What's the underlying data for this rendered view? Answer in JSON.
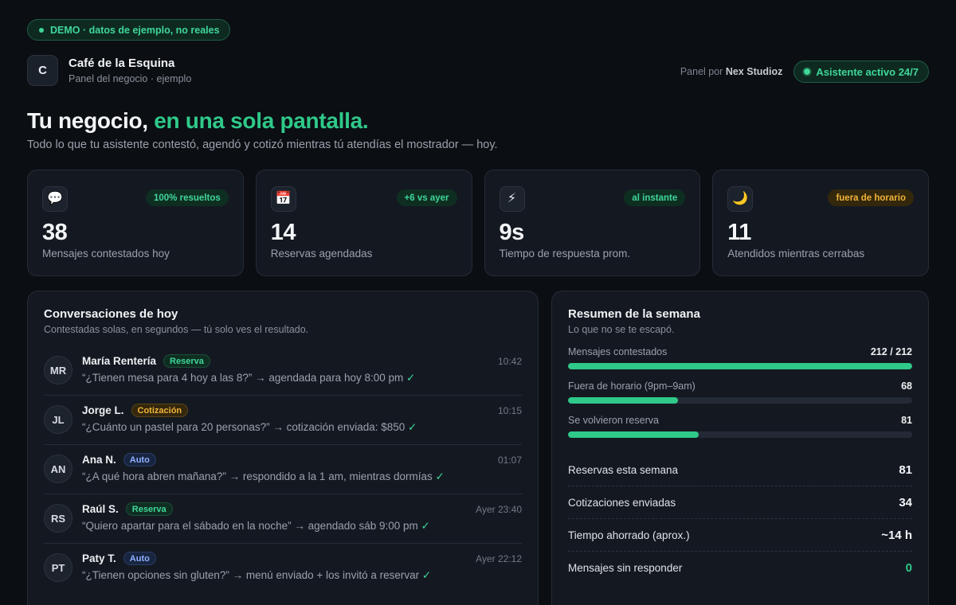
{
  "demo_pill": "DEMO · datos de ejemplo, no reales",
  "brand": {
    "initial": "C",
    "name": "Café de la Esquina",
    "subtitle": "Panel del negocio · ejemplo"
  },
  "header": {
    "panel_by_prefix": "Panel por",
    "panel_by_name": "Nex Studioz",
    "status": "Asistente activo 24/7"
  },
  "hero": {
    "title_plain": "Tu negocio, ",
    "title_accent": "en una sola pantalla.",
    "subtitle": "Todo lo que tu asistente contestó, agendó y cotizó mientras tú atendías el mostrador — hoy."
  },
  "stats": [
    {
      "icon": "💬",
      "icon_name": "speech-bubble-icon",
      "badge": "100% resueltos",
      "badge_kind": "good",
      "value": "38",
      "label": "Mensajes contestados hoy"
    },
    {
      "icon": "📅",
      "icon_name": "calendar-icon",
      "badge": "+6 vs ayer",
      "badge_kind": "good",
      "value": "14",
      "label": "Reservas agendadas"
    },
    {
      "icon": "⚡",
      "icon_name": "lightning-icon",
      "badge": "al instante",
      "badge_kind": "good",
      "value": "9s",
      "label": "Tiempo de respuesta prom."
    },
    {
      "icon": "🌙",
      "icon_name": "moon-icon",
      "badge": "fuera de horario",
      "badge_kind": "warn",
      "value": "11",
      "label": "Atendidos mientras cerrabas"
    }
  ],
  "conversations": {
    "title": "Conversaciones de hoy",
    "subtitle": "Contestadas solas, en segundos — tú solo ves el resultado.",
    "items": [
      {
        "initials": "MR",
        "name": "María Rentería",
        "tag": "Reserva",
        "tag_kind": "reserva",
        "message": "“¿Tienen mesa para 4 hoy a las 8?” → agendada para hoy 8:00 pm",
        "check": "✓",
        "time": "10:42"
      },
      {
        "initials": "JL",
        "name": "Jorge L.",
        "tag": "Cotización",
        "tag_kind": "cotizacion",
        "message": "“¿Cuánto un pastel para 20 personas?” → cotización enviada: $850",
        "check": "✓",
        "time": "10:15"
      },
      {
        "initials": "AN",
        "name": "Ana N.",
        "tag": "Auto",
        "tag_kind": "auto",
        "message": "“¿A qué hora abren mañana?” → respondido a la 1 am, mientras dormías",
        "check": "✓",
        "time": "01:07"
      },
      {
        "initials": "RS",
        "name": "Raúl S.",
        "tag": "Reserva",
        "tag_kind": "reserva",
        "message": "“Quiero apartar para el sábado en la noche” → agendado sáb 9:00 pm",
        "check": "✓",
        "time": "Ayer 23:40"
      },
      {
        "initials": "PT",
        "name": "Paty T.",
        "tag": "Auto",
        "tag_kind": "auto",
        "message": "“¿Tienen opciones sin gluten?” → menú enviado + los invitó a reservar",
        "check": "✓",
        "time": "Ayer 22:12"
      }
    ]
  },
  "weekly": {
    "title": "Resumen de la semana",
    "subtitle": "Lo que no se te escapó.",
    "bars": [
      {
        "label": "Mensajes contestados",
        "value_text": "212 / 212",
        "fraction": 1.0
      },
      {
        "label": "Fuera de horario (9pm–9am)",
        "value_text": "68",
        "fraction": 0.32
      },
      {
        "label": "Se volvieron reserva",
        "value_text": "81",
        "fraction": 0.38
      }
    ],
    "summary": [
      {
        "label": "Reservas esta semana",
        "value": "81",
        "kind": "normal"
      },
      {
        "label": "Cotizaciones enviadas",
        "value": "34",
        "kind": "normal"
      },
      {
        "label": "Tiempo ahorrado (aprox.)",
        "value": "~14 h",
        "kind": "normal"
      },
      {
        "label": "Mensajes sin responder",
        "value": "0",
        "kind": "good"
      }
    ]
  }
}
